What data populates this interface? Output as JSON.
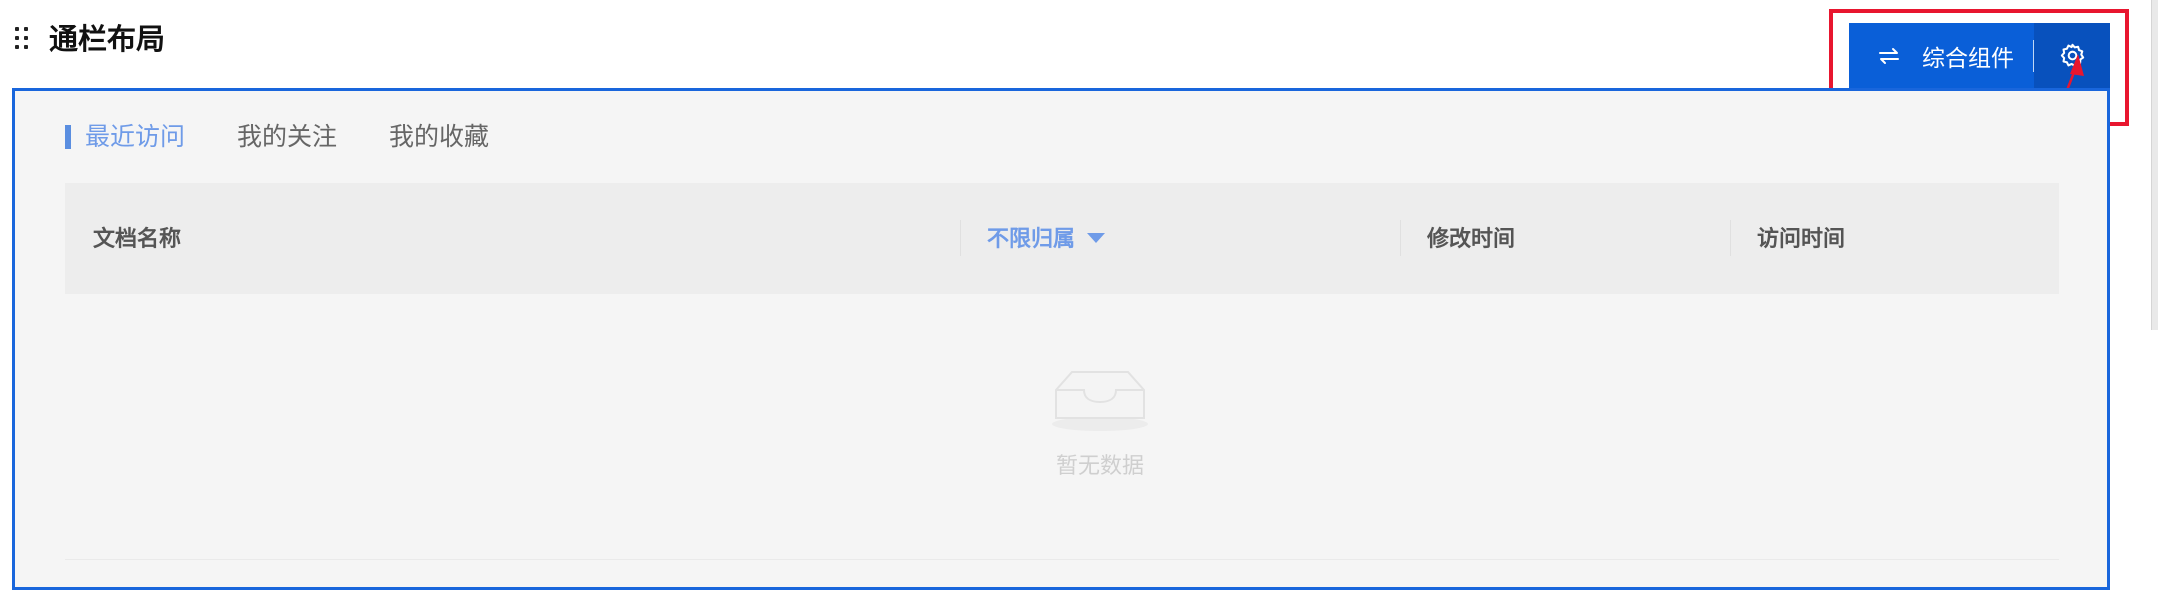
{
  "section": {
    "title": "通栏布局"
  },
  "toolbar": {
    "switch_label": "综合组件",
    "switch_icon": "swap-arrows-icon",
    "settings_icon": "gear-icon"
  },
  "tabs": [
    {
      "label": "最近访问",
      "active": true
    },
    {
      "label": "我的关注",
      "active": false
    },
    {
      "label": "我的收藏",
      "active": false
    }
  ],
  "table": {
    "columns": {
      "name": "文档名称",
      "owner_filter": "不限归属",
      "modified": "修改时间",
      "visited": "访问时间"
    },
    "rows": [],
    "empty_text": "暂无数据"
  },
  "colors": {
    "accent": "#0a5fd8",
    "panel_border": "#1966dc",
    "annotation": "#e8162f",
    "active_tab": "#6f9be8"
  }
}
